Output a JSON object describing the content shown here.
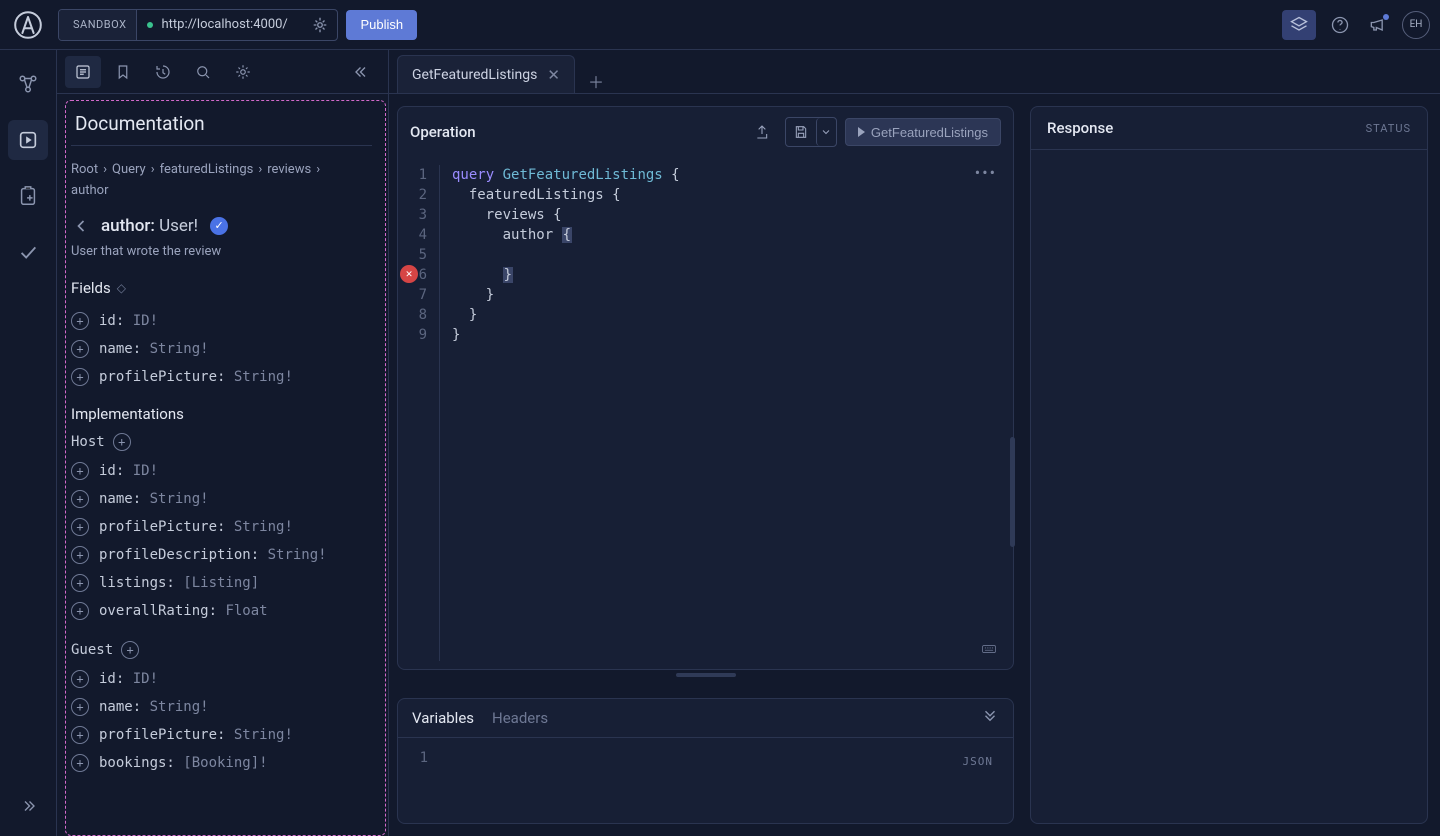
{
  "topbar": {
    "env_tag": "SANDBOX",
    "url": "http://localhost:4000/",
    "publish": "Publish",
    "avatar": "EH"
  },
  "tabs": {
    "active": "GetFeaturedListings"
  },
  "doc": {
    "title": "Documentation",
    "crumbs": [
      "Root",
      "Query",
      "featuredListings",
      "reviews",
      "author"
    ],
    "type_field": "author:",
    "type_type": " User!",
    "description": "User that wrote the review",
    "fields_header": "Fields",
    "fields": [
      {
        "name": "id:",
        "type": " ID!"
      },
      {
        "name": "name:",
        "type": " String!"
      },
      {
        "name": "profilePicture:",
        "type": " String!"
      }
    ],
    "implementations_header": "Implementations",
    "impls": [
      {
        "name": "Host",
        "fields": [
          {
            "name": "id:",
            "type": " ID!"
          },
          {
            "name": "name:",
            "type": " String!"
          },
          {
            "name": "profilePicture:",
            "type": " String!"
          },
          {
            "name": "profileDescription:",
            "type": " String!"
          },
          {
            "name": "listings:",
            "type": " [Listing]"
          },
          {
            "name": "overallRating:",
            "type": " Float"
          }
        ]
      },
      {
        "name": "Guest",
        "fields": [
          {
            "name": "id:",
            "type": " ID!"
          },
          {
            "name": "name:",
            "type": " String!"
          },
          {
            "name": "profilePicture:",
            "type": " String!"
          },
          {
            "name": "bookings:",
            "type": " [Booking]!"
          }
        ]
      }
    ]
  },
  "operation": {
    "header": "Operation",
    "run_label": "GetFeaturedListings",
    "lines": [
      {
        "n": "1"
      },
      {
        "n": "2"
      },
      {
        "n": "3"
      },
      {
        "n": "4"
      },
      {
        "n": "5"
      },
      {
        "n": "6"
      },
      {
        "n": "7"
      },
      {
        "n": "8"
      },
      {
        "n": "9"
      }
    ],
    "tokens": {
      "l1_kw": "query",
      "l1_name": "GetFeaturedListings",
      "l2": "featuredListings",
      "l3": "reviews",
      "l4": "author"
    }
  },
  "variables": {
    "tab_vars": "Variables",
    "tab_headers": "Headers",
    "line1": "1",
    "json": "JSON"
  },
  "response": {
    "header": "Response",
    "status": "STATUS"
  }
}
